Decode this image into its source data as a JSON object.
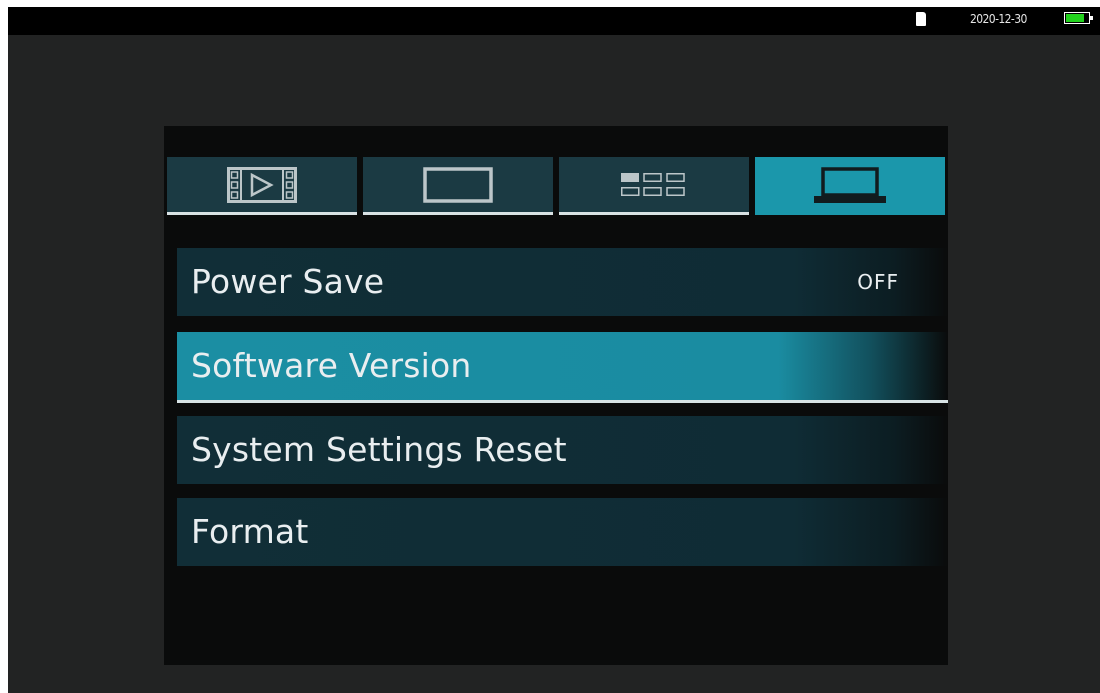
{
  "status_bar": {
    "date": "2020-12-30",
    "battery_level": 0.8,
    "battery_color": "#23d31e",
    "storage_icon": "sd-card-icon"
  },
  "tabs": [
    {
      "icon": "video-playback-icon",
      "active": false
    },
    {
      "icon": "screen-icon",
      "active": false
    },
    {
      "icon": "grid-view-icon",
      "active": false
    },
    {
      "icon": "laptop-icon",
      "active": true
    }
  ],
  "menu": {
    "items": [
      {
        "label": "Power Save",
        "value": "OFF",
        "selected": false
      },
      {
        "label": "Software Version",
        "value": "",
        "selected": true
      },
      {
        "label": "System Settings Reset",
        "value": "",
        "selected": false
      },
      {
        "label": "Format",
        "value": "",
        "selected": false
      }
    ]
  },
  "colors": {
    "accent": "#1b97ab",
    "item_background": "#112e37",
    "text": "#e9eef0"
  }
}
